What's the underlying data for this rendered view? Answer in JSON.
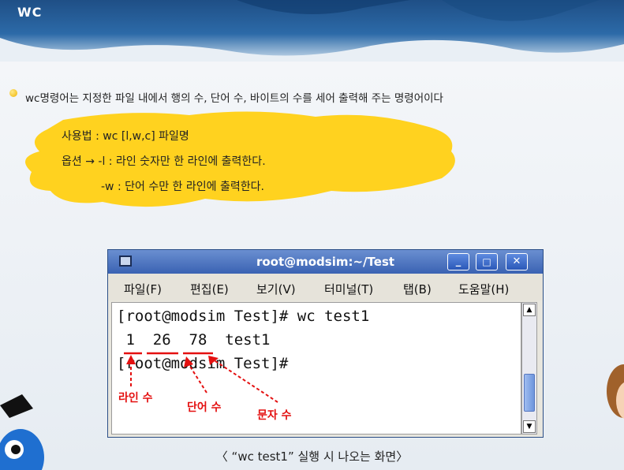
{
  "header": {
    "title": "WC"
  },
  "bullet": {
    "text": "wc명령어는 지정한 파일 내에서 행의 수, 단어 수, 바이트의 수를 세어 출력해 주는 명령어이다"
  },
  "usage": {
    "line1": "사용법 : wc [l,w,c] 파일명",
    "line2": "옵션 → -l : 라인 숫자만 한 라인에 출력한다.",
    "line3": "-w : 단어 수만 한 라인에 출력한다."
  },
  "window": {
    "title": "root@modsim:~/Test",
    "buttons": {
      "minimize": "_",
      "maximize": "□",
      "close": "✕"
    },
    "menu": [
      "파일(F)",
      "편집(E)",
      "보기(V)",
      "터미널(T)",
      "탭(B)",
      "도움말(H)"
    ],
    "terminal": {
      "line1": "[root@modsim Test]# wc test1",
      "line2": " 1  26  78  test1",
      "line3": "[root@modsim Test]#"
    }
  },
  "annotations": {
    "lines": "라인 수",
    "words": "단어 수",
    "chars": "문자 수"
  },
  "caption": "〈 “wc test1” 실행 시 나오는 화면〉",
  "colors": {
    "accent": "#e41010",
    "highlight": "#ffd21f",
    "titlebar": "#3a62b3"
  }
}
